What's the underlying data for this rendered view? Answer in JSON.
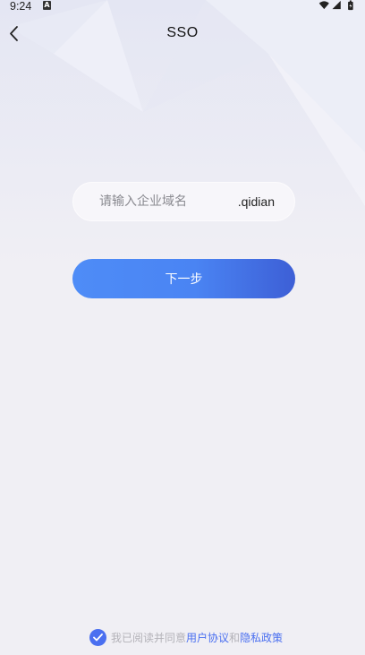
{
  "status_bar": {
    "time": "9:24",
    "notification_icon": "a-badge-icon",
    "icons": [
      "wifi-icon",
      "signal-icon",
      "battery-icon"
    ]
  },
  "header": {
    "title": "SSO",
    "back_icon": "chevron-left-icon"
  },
  "form": {
    "domain_placeholder": "请输入企业域名",
    "domain_value": "",
    "domain_suffix": ".qidian",
    "next_label": "下一步"
  },
  "agreement": {
    "checked": true,
    "prefix": "我已阅读并同意",
    "user_agreement": "用户协议",
    "conjunction": "和",
    "privacy_policy": "隐私政策"
  },
  "colors": {
    "accent": "#4a6ff0",
    "button_start": "#4e8cf7",
    "button_end": "#3d5fd6",
    "background": "#f0eff4"
  }
}
